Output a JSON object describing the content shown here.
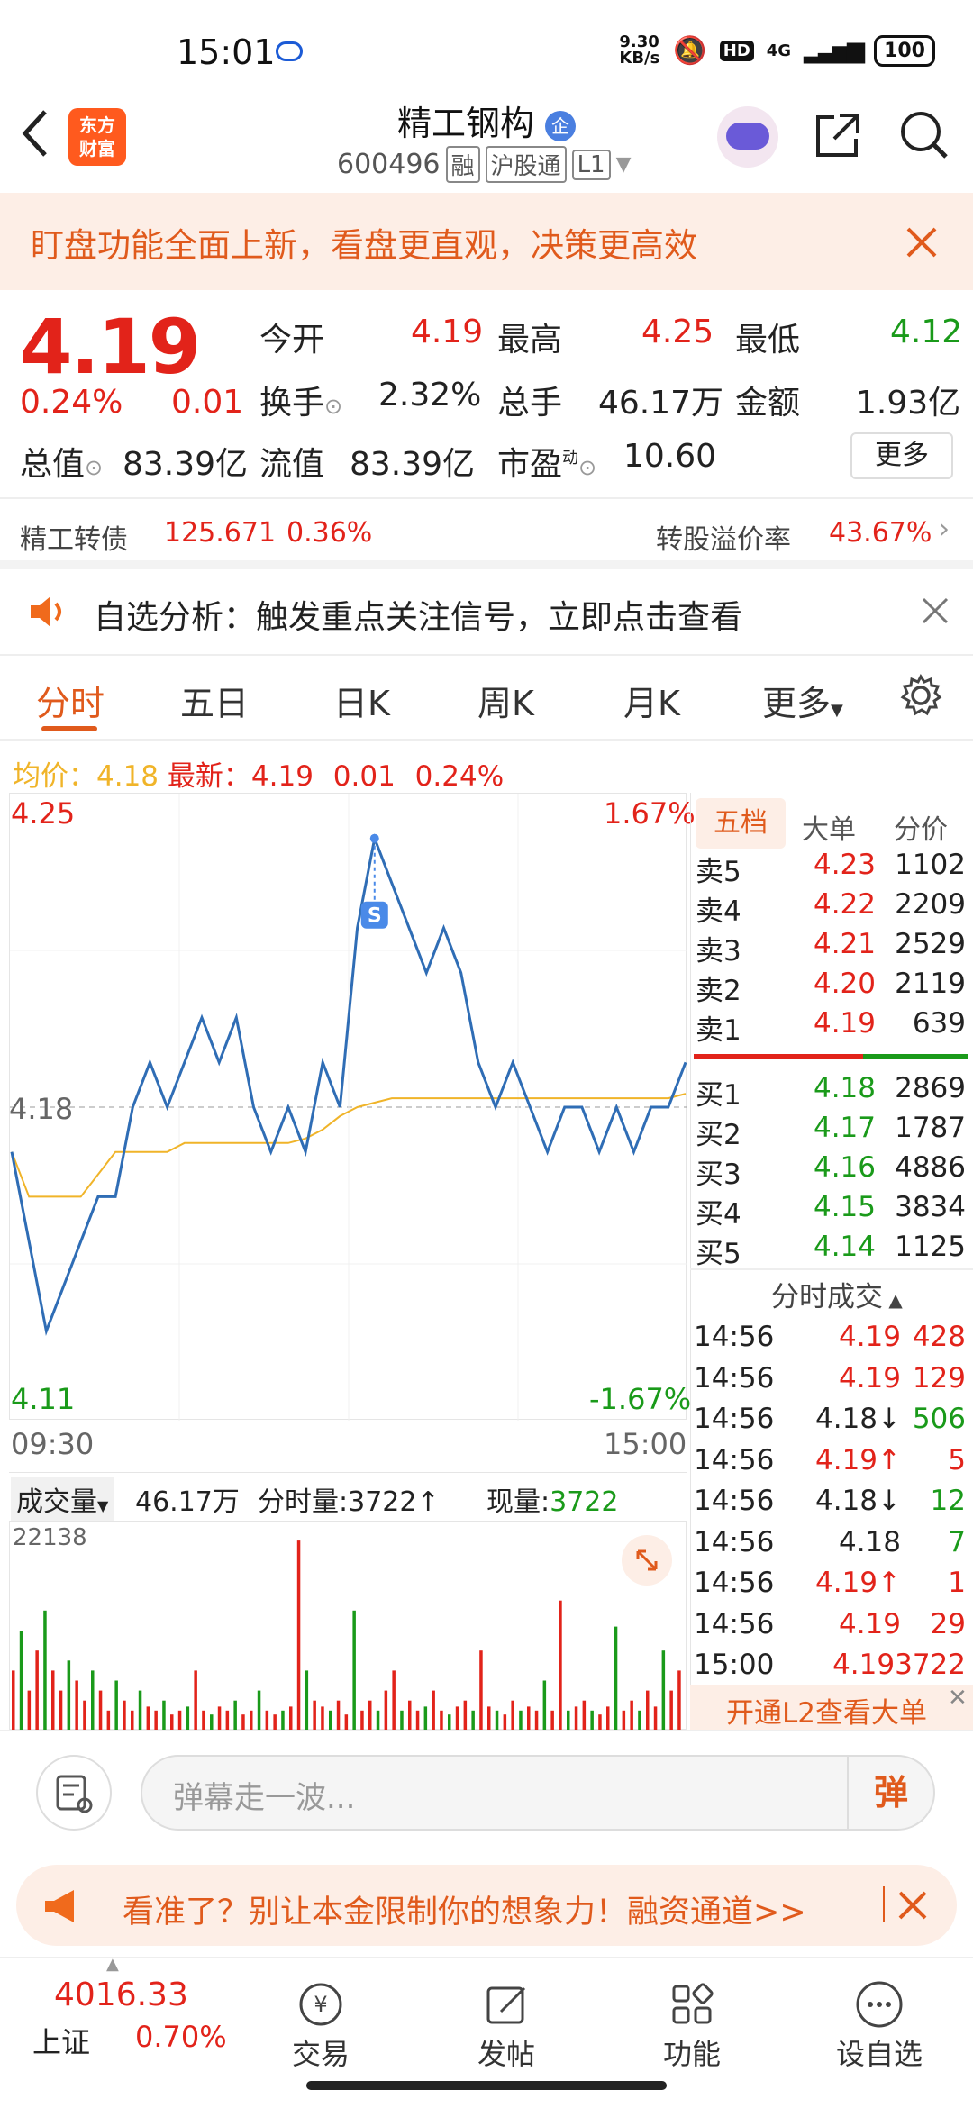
{
  "status_bar": {
    "time": "15:01",
    "net_speed": "9.30 KB/s",
    "hd": "HD",
    "signal": "4G",
    "battery": "100"
  },
  "header": {
    "title": "精工钢构",
    "title_badge": "企",
    "code": "600496",
    "tags": [
      "融",
      "沪股通",
      "L1"
    ],
    "logo_text": "东方财富"
  },
  "banner": {
    "text": "盯盘功能全面上新，看盘更直观，决策更高效"
  },
  "quote": {
    "price": "4.19",
    "change_pct": "0.24%",
    "change": "0.01",
    "open_label": "今开",
    "open": "4.19",
    "high_label": "最高",
    "high": "4.25",
    "low_label": "最低",
    "low": "4.12",
    "turnover_label": "换手",
    "turnover": "2.32%",
    "volume_label": "总手",
    "volume": "46.17万",
    "amount_label": "金额",
    "amount": "1.93亿",
    "mktcap_label": "总值",
    "mktcap": "83.39亿",
    "float_label": "流值",
    "float": "83.39亿",
    "pe_label": "市盈",
    "pe_sup": "动",
    "pe": "10.60",
    "more_button": "更多"
  },
  "bond": {
    "name": "精工转债",
    "price": "125.671",
    "pct": "0.36%",
    "premium_label": "转股溢价率",
    "premium": "43.67%"
  },
  "alert": {
    "text": "自选分析：触发重点关注信号，立即点击查看"
  },
  "tabs": [
    "分时",
    "五日",
    "日K",
    "周K",
    "月K",
    "更多"
  ],
  "summary": {
    "avg_label": "均价：",
    "avg": "4.18",
    "last_label": "最新：",
    "last": "4.19",
    "chg": "0.01",
    "pct": "0.24%"
  },
  "chart_data": {
    "type": "line",
    "y_axis_left": {
      "top": "4.25",
      "mid": "4.18",
      "bottom": "4.11"
    },
    "y_axis_right": {
      "top": "1.67%",
      "bottom": "-1.67%"
    },
    "x_axis": {
      "start": "09:30",
      "end": "15:00"
    },
    "ylim": [
      4.11,
      4.25
    ],
    "series": [
      {
        "values": [
          4.17,
          4.15,
          4.13,
          4.14,
          4.15,
          4.16,
          4.16,
          4.18,
          4.19,
          4.18,
          4.19,
          4.2,
          4.19,
          4.2,
          4.18,
          4.17,
          4.18,
          4.17,
          4.19,
          4.18,
          4.22,
          4.24,
          4.23,
          4.22,
          4.21,
          4.22,
          4.21,
          4.19,
          4.18,
          4.19,
          4.18,
          4.17,
          4.18,
          4.18,
          4.17,
          4.18,
          4.17,
          4.18,
          4.18,
          4.19
        ]
      },
      {
        "values": [
          4.17,
          4.16,
          4.16,
          4.16,
          4.16,
          4.165,
          4.17,
          4.17,
          4.17,
          4.17,
          4.172,
          4.172,
          4.172,
          4.172,
          4.172,
          4.172,
          4.172,
          4.173,
          4.175,
          4.178,
          4.18,
          4.181,
          4.182,
          4.182,
          4.182,
          4.182,
          4.182,
          4.182,
          4.182,
          4.182,
          4.182,
          4.182,
          4.182,
          4.182,
          4.182,
          4.182,
          4.182,
          4.182,
          4.182,
          4.183
        ]
      }
    ],
    "marker": "S"
  },
  "volume": {
    "label": "成交量",
    "total": "46.17万",
    "fenshi_label": "分时量:",
    "fenshi": "3722",
    "now_label": "现量:",
    "now": "3722",
    "max": "22138",
    "bars": [
      0.3,
      0.5,
      0.2,
      0.4,
      0.6,
      0.3,
      0.2,
      0.35,
      0.25,
      0.15,
      0.3,
      0.2,
      0.1,
      0.25,
      0.15,
      0.1,
      0.2,
      0.12,
      0.1,
      0.15,
      0.08,
      0.1,
      0.12,
      0.3,
      0.1,
      0.08,
      0.12,
      0.1,
      0.15,
      0.08,
      0.1,
      0.2,
      0.1,
      0.08,
      0.1,
      0.12,
      0.95,
      0.3,
      0.15,
      0.12,
      0.1,
      0.15,
      0.08,
      0.6,
      0.1,
      0.15,
      0.1,
      0.2,
      0.3,
      0.1,
      0.15,
      0.1,
      0.12,
      0.2,
      0.1,
      0.08,
      0.12,
      0.15,
      0.1,
      0.4,
      0.12,
      0.1,
      0.08,
      0.15,
      0.1,
      0.12,
      0.1,
      0.25,
      0.1,
      0.65,
      0.1,
      0.12,
      0.15,
      0.1,
      0.08,
      0.12,
      0.52,
      0.1,
      0.15,
      0.1,
      0.2,
      0.12,
      0.4,
      0.2,
      0.3
    ]
  },
  "order_book": {
    "tabs": [
      "五档",
      "大单",
      "分价"
    ],
    "asks": [
      {
        "label": "卖5",
        "price": "4.23",
        "vol": "1102"
      },
      {
        "label": "卖4",
        "price": "4.22",
        "vol": "2209"
      },
      {
        "label": "卖3",
        "price": "4.21",
        "vol": "2529"
      },
      {
        "label": "卖2",
        "price": "4.20",
        "vol": "2119"
      },
      {
        "label": "卖1",
        "price": "4.19",
        "vol": "639"
      }
    ],
    "bids": [
      {
        "label": "买1",
        "price": "4.18",
        "vol": "2869"
      },
      {
        "label": "买2",
        "price": "4.17",
        "vol": "1787"
      },
      {
        "label": "买3",
        "price": "4.16",
        "vol": "4886"
      },
      {
        "label": "买4",
        "price": "4.15",
        "vol": "3834"
      },
      {
        "label": "买5",
        "price": "4.14",
        "vol": "1125"
      }
    ],
    "trades_header": "分时成交",
    "trades": [
      {
        "time": "14:56",
        "price": "4.19",
        "vol": "428",
        "arrow": ""
      },
      {
        "time": "14:56",
        "price": "4.19",
        "vol": "129",
        "arrow": ""
      },
      {
        "time": "14:56",
        "price": "4.18",
        "vol": "506",
        "arrow": "↓"
      },
      {
        "time": "14:56",
        "price": "4.19",
        "vol": "5",
        "arrow": "↑"
      },
      {
        "time": "14:56",
        "price": "4.18",
        "vol": "12",
        "arrow": "↓"
      },
      {
        "time": "14:56",
        "price": "4.18",
        "vol": "7",
        "arrow": ""
      },
      {
        "time": "14:56",
        "price": "4.19",
        "vol": "1",
        "arrow": "↑"
      },
      {
        "time": "14:56",
        "price": "4.19",
        "vol": "29",
        "arrow": ""
      },
      {
        "time": "15:00",
        "price": "4.19",
        "vol": "3722",
        "arrow": ""
      }
    ],
    "l2_text": "开通L2查看大单"
  },
  "danmaku": {
    "placeholder": "弹幕走一波...",
    "send": "弹"
  },
  "promo": {
    "text": "看准了？别让本金限制你的想象力！融资通道>>"
  },
  "bottom_nav": {
    "index_value": "4016.33",
    "index_name": "上证",
    "index_pct": "0.70%",
    "items": [
      "交易",
      "发帖",
      "功能",
      "设自选"
    ]
  },
  "colors": {
    "up": "#e2231a",
    "down": "#1a9a1a",
    "accent": "#e05a1c",
    "line": "#2f6db5",
    "avg": "#f0b429"
  }
}
